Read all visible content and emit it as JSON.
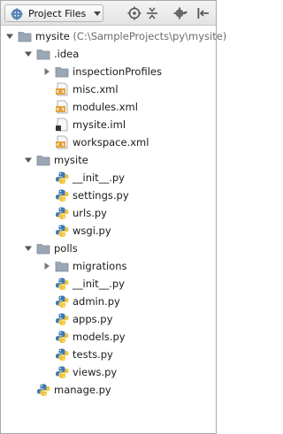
{
  "header": {
    "view_label": "Project Files",
    "icons": [
      "project-files-icon",
      "dropdown-arrow-icon",
      "locate-icon",
      "collapse-all-icon",
      "settings-icon",
      "hide-icon"
    ]
  },
  "tree": {
    "rows": [
      {
        "label": "mysite",
        "suffix": " (C:\\SampleProjects\\py\\mysite)",
        "kind": "folder",
        "expanded": true,
        "depth": 0
      },
      {
        "label": ".idea",
        "kind": "folder",
        "expanded": true,
        "depth": 1
      },
      {
        "label": "inspectionProfiles",
        "kind": "folder",
        "expanded": false,
        "depth": 2
      },
      {
        "label": "misc.xml",
        "kind": "xml",
        "depth": 2
      },
      {
        "label": "modules.xml",
        "kind": "xml",
        "depth": 2
      },
      {
        "label": "mysite.iml",
        "kind": "iml",
        "depth": 2
      },
      {
        "label": "workspace.xml",
        "kind": "xml",
        "depth": 2
      },
      {
        "label": "mysite",
        "kind": "folder",
        "expanded": true,
        "depth": 1
      },
      {
        "label": "__init__.py",
        "kind": "python",
        "depth": 2
      },
      {
        "label": "settings.py",
        "kind": "python",
        "depth": 2
      },
      {
        "label": "urls.py",
        "kind": "python",
        "depth": 2
      },
      {
        "label": "wsgi.py",
        "kind": "python",
        "depth": 2
      },
      {
        "label": "polls",
        "kind": "folder",
        "expanded": true,
        "depth": 1
      },
      {
        "label": "migrations",
        "kind": "folder",
        "expanded": false,
        "depth": 2
      },
      {
        "label": "__init__.py",
        "kind": "python",
        "depth": 2
      },
      {
        "label": "admin.py",
        "kind": "python",
        "depth": 2
      },
      {
        "label": "apps.py",
        "kind": "python",
        "depth": 2
      },
      {
        "label": "models.py",
        "kind": "python",
        "depth": 2
      },
      {
        "label": "tests.py",
        "kind": "python",
        "depth": 2
      },
      {
        "label": "views.py",
        "kind": "python",
        "depth": 2
      },
      {
        "label": "manage.py",
        "kind": "python",
        "depth": 1
      }
    ]
  },
  "colors": {
    "folder": "#9aa7b5",
    "xml": "#e2a33b",
    "python_blue": "#3b77b0",
    "python_yellow": "#f3c538"
  }
}
